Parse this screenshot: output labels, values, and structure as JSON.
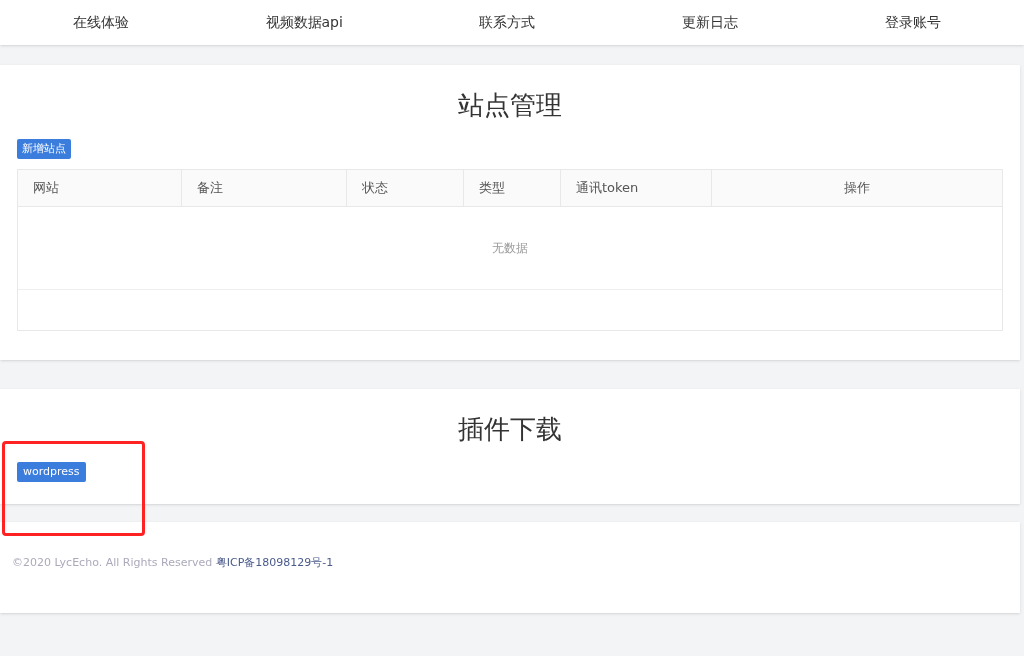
{
  "nav": {
    "items": [
      "在线体验",
      "视频数据api",
      "联系方式",
      "更新日志",
      "登录账号"
    ]
  },
  "site_management": {
    "title": "站点管理",
    "add_button": "新增站点",
    "table": {
      "columns": [
        "网站",
        "备注",
        "状态",
        "类型",
        "通讯token",
        "操作"
      ],
      "empty_text": "无数据"
    }
  },
  "plugin_download": {
    "title": "插件下载",
    "buttons": [
      "wordpress"
    ]
  },
  "footer": {
    "copyright": "©2020 LycEcho. All Rights Reserved",
    "icp_link": "粤ICP备18098129号-1"
  }
}
